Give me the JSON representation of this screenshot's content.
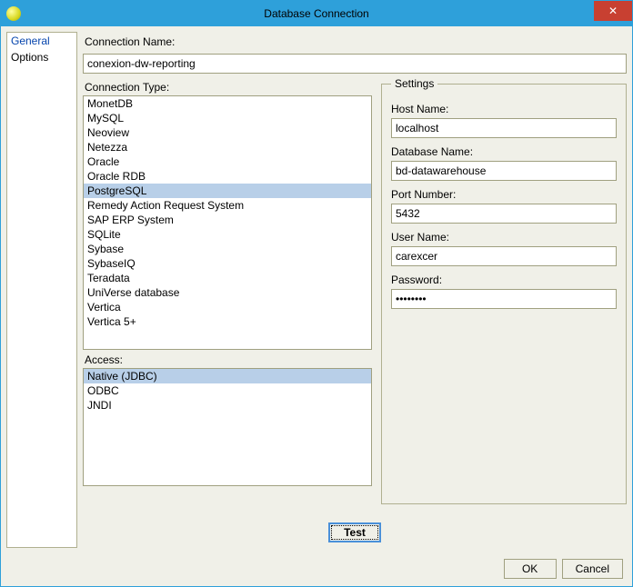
{
  "titlebar": {
    "title": "Database Connection",
    "close": "✕"
  },
  "nav": {
    "general": "General",
    "options": "Options"
  },
  "labels": {
    "connection_name": "Connection Name:",
    "connection_type": "Connection Type:",
    "access": "Access:",
    "settings_legend": "Settings",
    "host_name": "Host Name:",
    "database_name": "Database Name:",
    "port_number": "Port Number:",
    "user_name": "User Name:",
    "password": "Password:"
  },
  "values": {
    "connection_name": "conexion-dw-reporting",
    "host_name": "localhost",
    "database_name": "bd-datawarehouse",
    "port_number": "5432",
    "user_name": "carexcer",
    "password": "••••••••"
  },
  "connection_types": [
    {
      "label": "MonetDB",
      "selected": false
    },
    {
      "label": "MySQL",
      "selected": false
    },
    {
      "label": "Neoview",
      "selected": false
    },
    {
      "label": "Netezza",
      "selected": false
    },
    {
      "label": "Oracle",
      "selected": false
    },
    {
      "label": "Oracle RDB",
      "selected": false
    },
    {
      "label": "PostgreSQL",
      "selected": true
    },
    {
      "label": "Remedy Action Request System",
      "selected": false
    },
    {
      "label": "SAP ERP System",
      "selected": false
    },
    {
      "label": "SQLite",
      "selected": false
    },
    {
      "label": "Sybase",
      "selected": false
    },
    {
      "label": "SybaseIQ",
      "selected": false
    },
    {
      "label": "Teradata",
      "selected": false
    },
    {
      "label": "UniVerse database",
      "selected": false
    },
    {
      "label": "Vertica",
      "selected": false
    },
    {
      "label": "Vertica 5+",
      "selected": false
    }
  ],
  "access_types": [
    {
      "label": "Native (JDBC)",
      "selected": true
    },
    {
      "label": "ODBC",
      "selected": false
    },
    {
      "label": "JNDI",
      "selected": false
    }
  ],
  "buttons": {
    "test": "Test",
    "ok": "OK",
    "cancel": "Cancel"
  }
}
